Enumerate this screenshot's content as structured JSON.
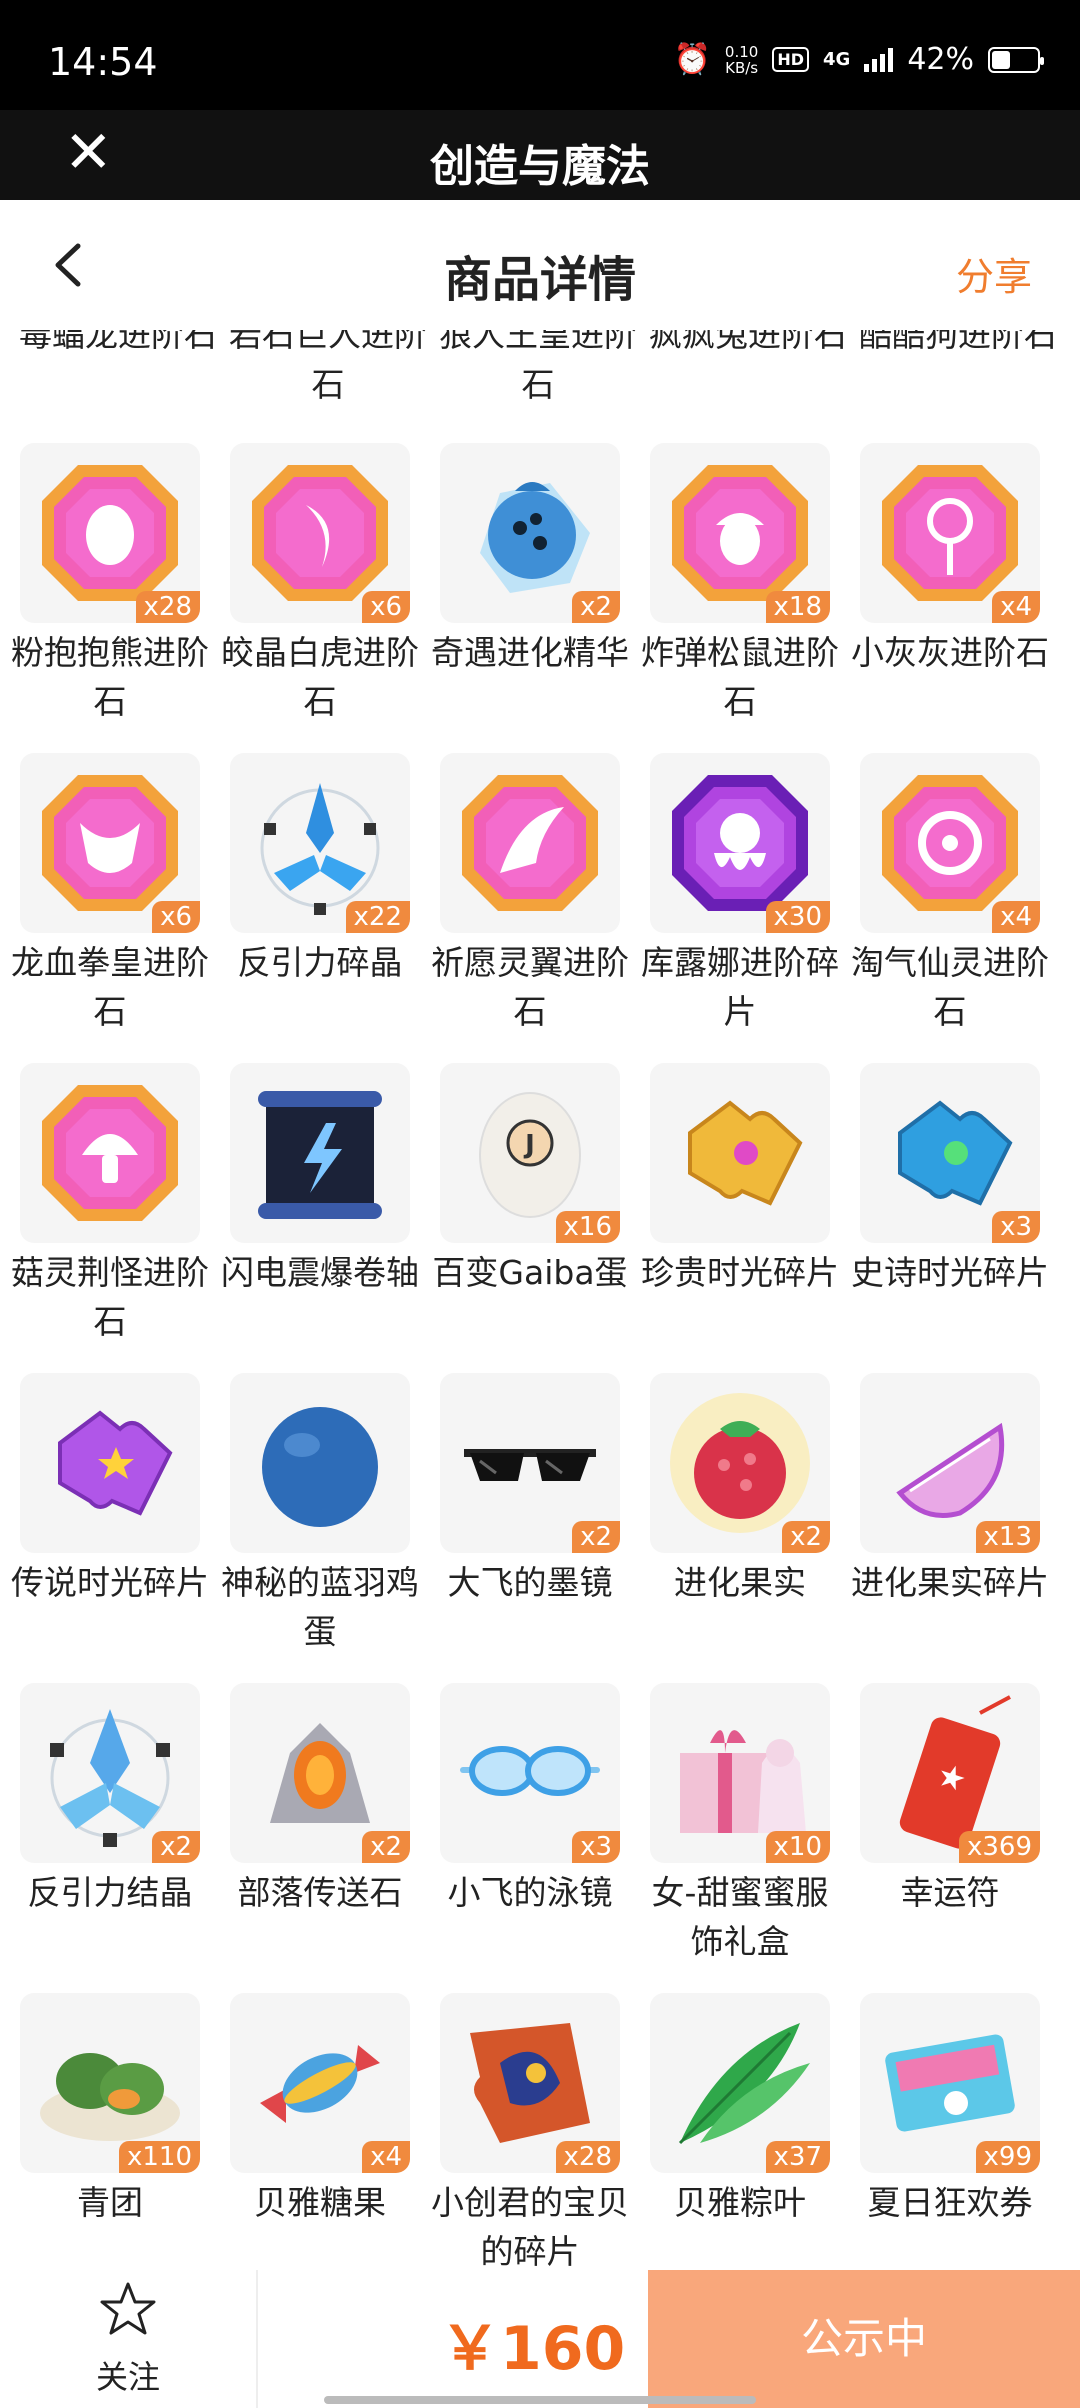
{
  "status_bar": {
    "time": "14:54",
    "net_speed_value": "0.10",
    "net_speed_unit": "KB/s",
    "hd": "HD",
    "network": "4G",
    "battery": "42%"
  },
  "app": {
    "title": "创造与魔法"
  },
  "page": {
    "title": "商品详情",
    "share_label": "分享"
  },
  "partial_row": [
    "毒蝠龙进阶石",
    "岩石巨人进阶石",
    "狼人王皇进阶石",
    "疯疯兔进阶石",
    "酷酷狗进阶石"
  ],
  "items": [
    {
      "name": "粉抱抱熊进阶石",
      "qty": "x28",
      "icon": "pink-gem-egg-icon"
    },
    {
      "name": "皎晶白虎进阶石",
      "qty": "x6",
      "icon": "pink-gem-claw-icon"
    },
    {
      "name": "奇遇进化精华",
      "qty": "x2",
      "icon": "blue-crystal-berry-icon"
    },
    {
      "name": "炸弹松鼠进阶石",
      "qty": "x18",
      "icon": "pink-gem-acorn-icon"
    },
    {
      "name": "小灰灰进阶石",
      "qty": "x4",
      "icon": "pink-gem-lollipop-icon"
    },
    {
      "name": "龙血拳皇进阶石",
      "qty": "x6",
      "icon": "pink-gem-bull-icon"
    },
    {
      "name": "反引力碎晶",
      "qty": "x22",
      "icon": "antigravity-shard-icon"
    },
    {
      "name": "祈愿灵翼进阶石",
      "qty": "",
      "icon": "pink-gem-wing-icon"
    },
    {
      "name": "库露娜进阶碎片",
      "qty": "x30",
      "icon": "purple-gem-octopus-icon"
    },
    {
      "name": "淘气仙灵进阶石",
      "qty": "x4",
      "icon": "pink-gem-sprite-icon"
    },
    {
      "name": "菇灵荆怪进阶石",
      "qty": "",
      "icon": "pink-gem-mushroom-icon"
    },
    {
      "name": "闪电震爆卷轴",
      "qty": "",
      "icon": "lightning-scroll-icon"
    },
    {
      "name": "百变Gaiba蛋",
      "qty": "x16",
      "icon": "gaiba-egg-icon"
    },
    {
      "name": "珍贵时光碎片",
      "qty": "",
      "icon": "gold-puzzle-piece-icon"
    },
    {
      "name": "史诗时光碎片",
      "qty": "x3",
      "icon": "blue-puzzle-piece-icon"
    },
    {
      "name": "传说时光碎片",
      "qty": "",
      "icon": "purple-puzzle-piece-icon"
    },
    {
      "name": "神秘的蓝羽鸡蛋",
      "qty": "",
      "icon": "blue-egg-icon"
    },
    {
      "name": "大飞的墨镜",
      "qty": "x2",
      "icon": "sunglasses-icon"
    },
    {
      "name": "进化果实",
      "qty": "x2",
      "icon": "evolution-fruit-icon"
    },
    {
      "name": "进化果实碎片",
      "qty": "x13",
      "icon": "fruit-slice-icon"
    },
    {
      "name": "反引力结晶",
      "qty": "x2",
      "icon": "antigravity-crystal-icon"
    },
    {
      "name": "部落传送石",
      "qty": "x2",
      "icon": "teleport-stone-icon"
    },
    {
      "name": "小飞的泳镜",
      "qty": "x3",
      "icon": "swim-goggles-icon"
    },
    {
      "name": "女-甜蜜蜜服饰礼盒",
      "qty": "x10",
      "icon": "gift-box-icon"
    },
    {
      "name": "幸运符",
      "qty": "x369",
      "icon": "lucky-charm-icon"
    },
    {
      "name": "青团",
      "qty": "x110",
      "icon": "green-rice-ball-icon"
    },
    {
      "name": "贝雅糖果",
      "qty": "x4",
      "icon": "candy-icon"
    },
    {
      "name": "小创君的宝贝的碎片",
      "qty": "x28",
      "icon": "puzzle-fragment-icon"
    },
    {
      "name": "贝雅粽叶",
      "qty": "x37",
      "icon": "bamboo-leaf-icon"
    },
    {
      "name": "夏日狂欢券",
      "qty": "x99",
      "icon": "summer-ticket-icon"
    }
  ],
  "bottom_bar": {
    "favorite_label": "关注",
    "price": "￥160",
    "status_label": "公示中"
  },
  "colors": {
    "accent": "#f06a1e",
    "badge": "#f08a3e",
    "status_button": "#f9a77b"
  }
}
